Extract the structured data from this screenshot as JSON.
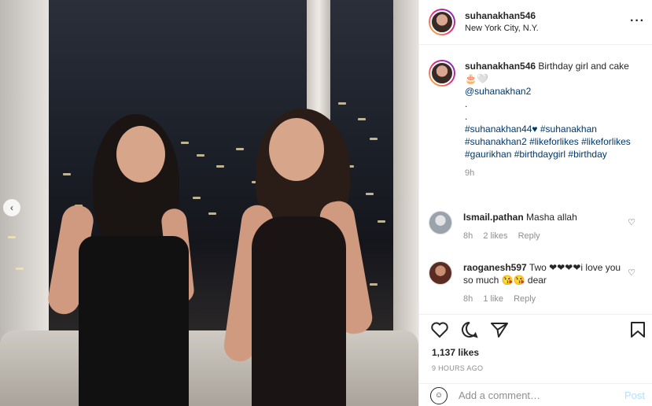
{
  "post": {
    "username": "suhanakhan546",
    "location": "New York City, N.Y."
  },
  "caption": {
    "username": "suhanakhan546",
    "text": "Birthday girl and cake 🎂🤍",
    "mention": "@suhanakhan2",
    "dots": [
      ".",
      "."
    ],
    "hashtags": "#suhanakhan44♥ #suhanakhan #suhanakhan2 #likeforlikes #likeforlikes #gaurikhan #birthdaygirl #birthday",
    "age": "9h"
  },
  "comments": [
    {
      "username": "Ismail.pathan",
      "text": "Masha allah",
      "age": "8h",
      "likes": "2 likes",
      "reply": "Reply"
    },
    {
      "username": "raoganesh597",
      "text": "Two ❤❤❤❤i love you so much 😘😘 dear",
      "age": "8h",
      "likes": "1 like",
      "reply": "Reply"
    }
  ],
  "engagement": {
    "likes": "1,137 likes",
    "posted": "9 HOURS AGO"
  },
  "composer": {
    "placeholder": "Add a comment…",
    "post_label": "Post"
  },
  "icons": {
    "more": "more-options-icon",
    "like": "heart-icon",
    "comment": "comment-icon",
    "share": "share-icon",
    "save": "bookmark-icon",
    "emoji": "emoji-icon",
    "prev": "chevron-left-icon"
  }
}
